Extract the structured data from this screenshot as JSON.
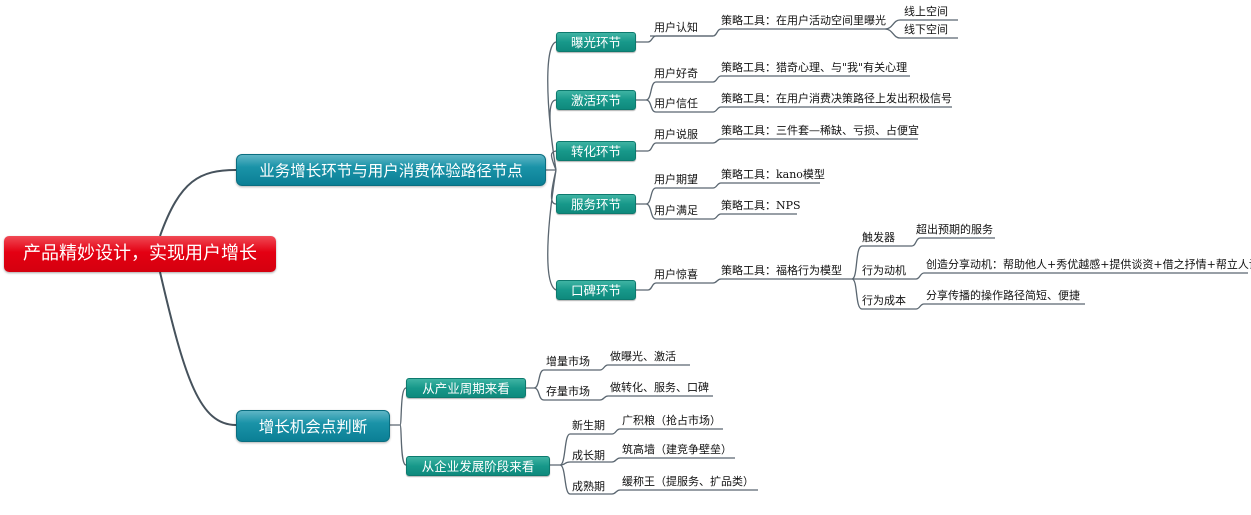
{
  "root": {
    "label": "产品精妙设计，实现用户增长"
  },
  "branches": [
    {
      "label": "业务增长环节与用户消费体验路径节点",
      "stages": [
        {
          "label": "曝光环节",
          "needs": [
            {
              "label": "用户认知",
              "tool": "策略工具：在用户活动空间里曝光",
              "details": [
                "线上空间",
                "线下空间"
              ]
            }
          ]
        },
        {
          "label": "激活环节",
          "needs": [
            {
              "label": "用户好奇",
              "tool": "策略工具：猎奇心理、与\"我\"有关心理"
            },
            {
              "label": "用户信任",
              "tool": "策略工具：在用户消费决策路径上发出积极信号"
            }
          ]
        },
        {
          "label": "转化环节",
          "needs": [
            {
              "label": "用户说服",
              "tool": "策略工具：三件套—稀缺、亏损、占便宜"
            }
          ]
        },
        {
          "label": "服务环节",
          "needs": [
            {
              "label": "用户期望",
              "tool": "策略工具：kano模型"
            },
            {
              "label": "用户满足",
              "tool": "策略工具：NPS"
            }
          ]
        },
        {
          "label": "口碑环节",
          "needs": [
            {
              "label": "用户惊喜",
              "tool": "策略工具：福格行为模型",
              "factors": [
                {
                  "label": "触发器",
                  "value": "超出预期的服务"
                },
                {
                  "label": "行为动机",
                  "value": "创造分享动机：帮助他人+秀优越感+提供谈资+借之抒情+帮立人设"
                },
                {
                  "label": "行为成本",
                  "value": "分享传播的操作路径简短、便捷"
                }
              ]
            }
          ]
        }
      ]
    },
    {
      "label": "增长机会点判断",
      "views": [
        {
          "label": "从产业周期来看",
          "items": [
            {
              "label": "增量市场",
              "value": "做曝光、激活"
            },
            {
              "label": "存量市场",
              "value": "做转化、服务、口碑"
            }
          ]
        },
        {
          "label": "从企业发展阶段来看",
          "items": [
            {
              "label": "新生期",
              "value": "广积粮（抢占市场）"
            },
            {
              "label": "成长期",
              "value": "筑高墙（建竞争壁垒）"
            },
            {
              "label": "成熟期",
              "value": "缓称王（提服务、扩品类）"
            }
          ]
        }
      ]
    }
  ],
  "colors": {
    "root": "#e40012",
    "main_branch": "#1a93a8",
    "sub_branch": "#17988a",
    "connector": "#5a6670"
  }
}
